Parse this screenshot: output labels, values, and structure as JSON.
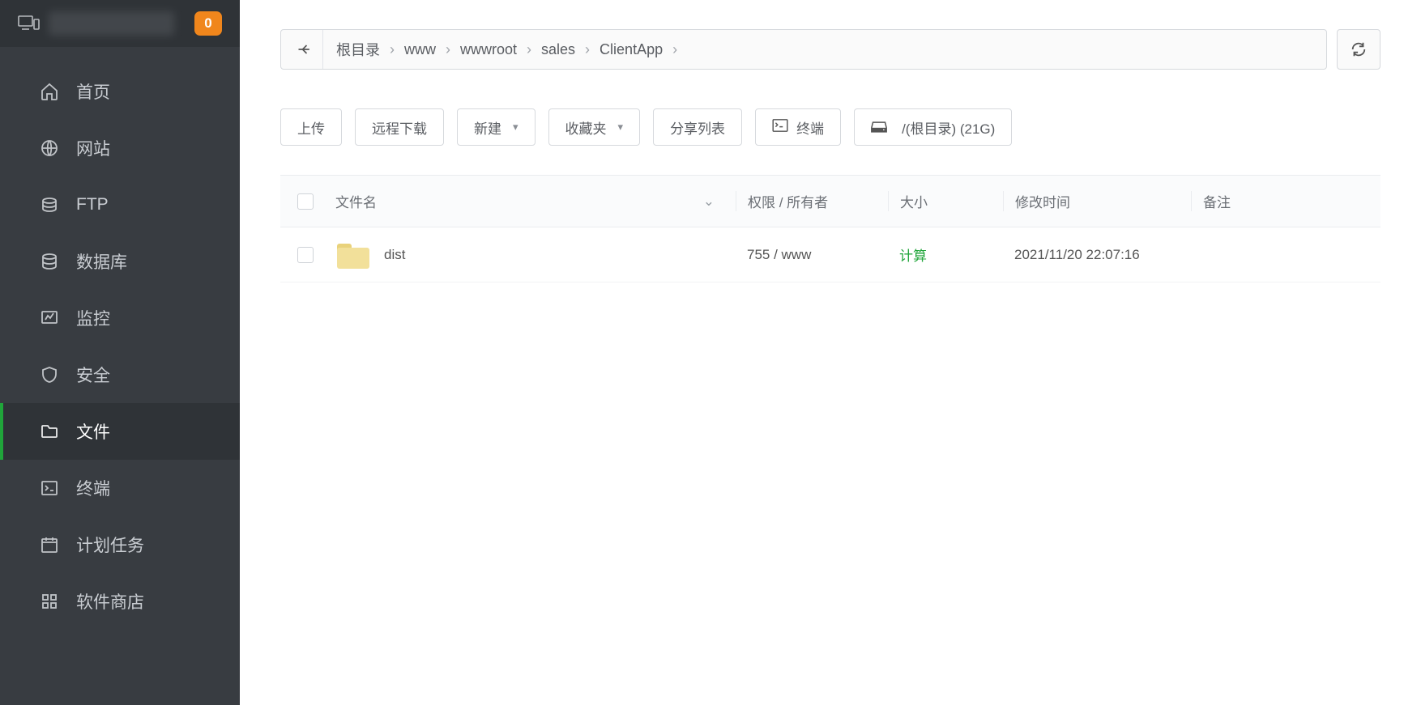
{
  "badge_count": "0",
  "sidebar": {
    "items": [
      {
        "label": "首页",
        "icon": "home"
      },
      {
        "label": "网站",
        "icon": "globe"
      },
      {
        "label": "FTP",
        "icon": "ftp"
      },
      {
        "label": "数据库",
        "icon": "database"
      },
      {
        "label": "监控",
        "icon": "monitor"
      },
      {
        "label": "安全",
        "icon": "shield"
      },
      {
        "label": "文件",
        "icon": "folder"
      },
      {
        "label": "终端",
        "icon": "terminal"
      },
      {
        "label": "计划任务",
        "icon": "calendar"
      },
      {
        "label": "软件商店",
        "icon": "apps"
      }
    ]
  },
  "breadcrumbs": [
    "根目录",
    "www",
    "wwwroot",
    "sales",
    "ClientApp"
  ],
  "toolbar": {
    "upload_label": "上传",
    "remote_dl_label": "远程下载",
    "new_label": "新建",
    "favorite_label": "收藏夹",
    "share_label": "分享列表",
    "terminal_label": "终端",
    "disk_label": "/(根目录) (21G)"
  },
  "table": {
    "headers": {
      "name": "文件名",
      "perm": "权限 / 所有者",
      "size": "大小",
      "time": "修改时间",
      "note": "备注"
    },
    "rows": [
      {
        "name": "dist",
        "perm": "755 / www",
        "size_label": "计算",
        "time": "2021/11/20 22:07:16",
        "note": ""
      }
    ]
  }
}
